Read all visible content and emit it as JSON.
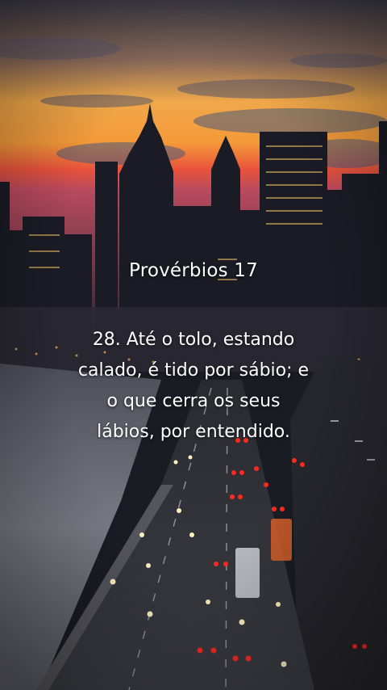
{
  "overlay": {
    "title": "Provérbios 17",
    "verse_lines": [
      "28. Até o tolo, estando",
      "calado, é tido por sábio; e",
      "o que cerra os seus",
      "lábios, por entendido."
    ]
  },
  "colors": {
    "sky_top": "#3d3a4a",
    "sky_glow": "#f4a23a",
    "horizon": "#e0403a",
    "city_dark": "#15171e",
    "water": "#6d6f7a",
    "headlight": "#fff2c0",
    "taillight": "#ff2a1f"
  }
}
